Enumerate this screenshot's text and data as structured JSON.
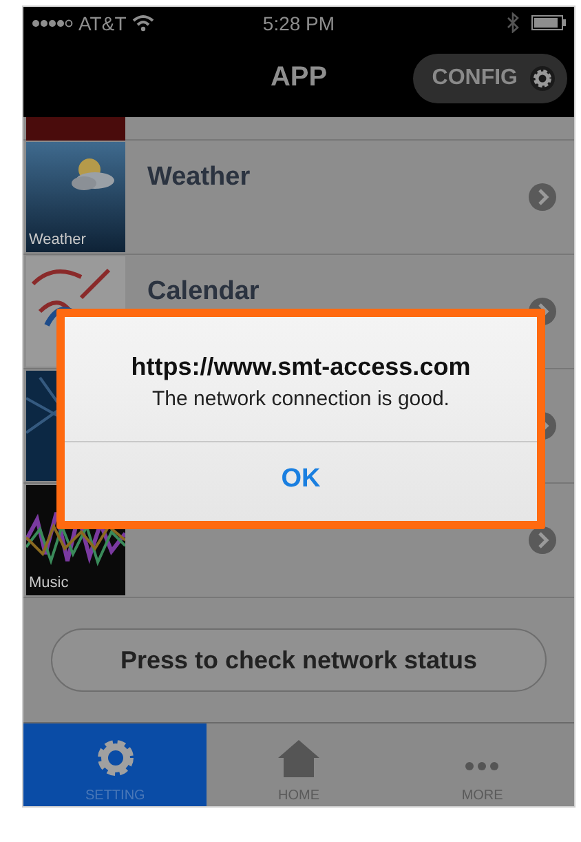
{
  "status_bar": {
    "carrier": "AT&T",
    "time": "5:28 PM"
  },
  "nav_bar": {
    "title": "APP",
    "config_button": "CONFIG"
  },
  "list": [
    {
      "kind": "heart"
    },
    {
      "kind": "weather",
      "title": "Weather",
      "caption": "Weather"
    },
    {
      "kind": "calendar",
      "title": "Calendar"
    },
    {
      "kind": "news"
    },
    {
      "kind": "music",
      "caption": "Music"
    }
  ],
  "check_button": "Press to check network status",
  "alert": {
    "title": "https://www.smt-access.com",
    "message": "The network connection is good.",
    "button": "OK",
    "highlighted": true
  },
  "tabs": [
    {
      "kind": "gear",
      "label": "SETTING",
      "selected": true
    },
    {
      "kind": "house",
      "label": "HOME",
      "selected": false
    },
    {
      "kind": "dots",
      "label": "MORE",
      "selected": false
    }
  ]
}
